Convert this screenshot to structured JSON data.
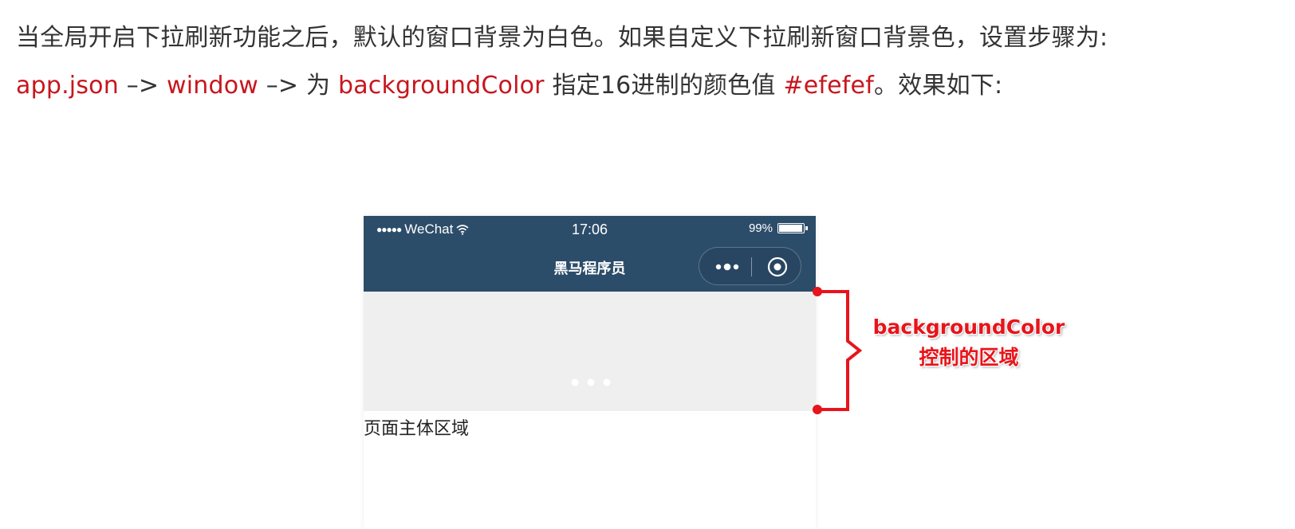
{
  "article": {
    "line1": "当全局开启下拉刷新功能之后，默认的窗口背景为白色。如果自定义下拉刷新窗口背景色，设置步骤为:",
    "line2": {
      "seg1": "app.json",
      "seg2": " –> ",
      "seg3": "window",
      "seg4": " –> 为 ",
      "seg5": "backgroundColor",
      "seg6": " 指定16进制的颜色值 ",
      "seg7": "#efefef",
      "seg8": "。效果如下:"
    },
    "highlight_color": "#c7161e"
  },
  "phone": {
    "status": {
      "signal": "●●●●●",
      "carrier": "WeChat",
      "time": "17:06",
      "battery": "99%"
    },
    "nav_title": "黑马程序员",
    "navbar_color": "#2c4d6a",
    "capsule_icons": [
      "more-icon",
      "close-icon"
    ],
    "refresh_background": "#efefef",
    "body_text": "页面主体区域"
  },
  "annotation": {
    "label_line1": "backgroundColor",
    "label_line2": "控制的区域",
    "color": "#e8141b"
  }
}
